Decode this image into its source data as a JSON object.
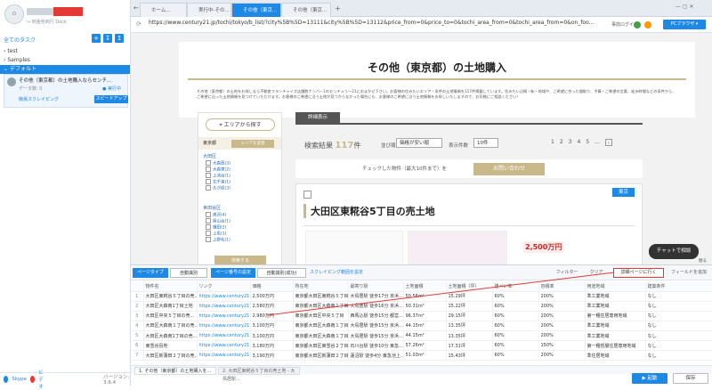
{
  "sidebar": {
    "login_link": "↪ 到金色到行 Dock",
    "title": "全てのタスク",
    "tree": [
      "test",
      "Samples",
      "デフォルト"
    ],
    "task": {
      "title": "その他（東京都）の土地購入ならセンチ...",
      "sub": "データ数: 0",
      "status": "● 実行中",
      "link": "簡易スクレイピング",
      "speedup": "スピードアップ"
    },
    "footer": {
      "skype": "Skype",
      "video": "ビデオ",
      "version": "バージョン: 3.6.4"
    }
  },
  "browser": {
    "tabs": [
      "ホーム...",
      "実行中-その...",
      "その他（東京...",
      "その他（東京..."
    ],
    "url": "https://www.century21.jp/tochi/tokyo/b_list/?city%5B%5D=13111&city%5B%5D=13112&price_from=0&price_to=0&tochi_area_from=0&tochi_area_from=0&on_foo...",
    "login": "事前ログイン",
    "pc_browser": "PCブラウザ ▾"
  },
  "page": {
    "h1": "その他（東京都）の土地購入",
    "intro": "その他（東京都）の土地をお探しなら不動産フランチャイズ店舗数ナンバー1のセンチュリー21におまかせ下さい。お客様の住みたいエリア・条件の土地情報を117件掲載しています。住みたい沿線・駅・地域や、ご希望に合った間取り、予算・ご希望の言葉、徒歩時間などの条件から、ご希望に沿った土地情報を見つけていただけます。お客様のご希望に沿う土地が見つからなかった場合にも、お客様のご希望に沿う土地情報をお探しいたしますので、お気軽にご相談ください！",
    "area_btn": "エリアから探す",
    "tokyo": "東京都",
    "change_area": "エリアを変更",
    "ward1": "大田区",
    "ward1_items": [
      "大森西(3)",
      "大森東(2)",
      "上池台(1)",
      "北千束(1)",
      "久が原(3)"
    ],
    "ward2": "世田谷区",
    "ward2_items": [
      "奥沢(4)",
      "尾山台(1)",
      "鎌田(2)",
      "上馬(1)",
      "上野毛(1)"
    ],
    "search_btn": "検索する",
    "tab": "詳細表示",
    "count_label": "検索結果",
    "count": "117",
    "count_unit": "件",
    "sort_label": "並び順",
    "sort": "価格が安い順",
    "disp_label": "表示件数",
    "disp": "10件",
    "pages": [
      "1",
      "2",
      "3",
      "4",
      "5",
      "..."
    ],
    "inq_text": "チェックした物件（最大10件まで）を",
    "inq_btn": "お問い合わせ",
    "tokyo_badge": "東京",
    "card_title": "大田区東糀谷5丁目の売土地",
    "price": "2,500万円",
    "chat": "チャットで相談",
    "close": "閉る"
  },
  "toolbar": {
    "loop": "ページタイプ",
    "auto": "自動識別",
    "paging": "ページ番号の設定",
    "auto2": "自動識別(成功)",
    "scroll": "スクレイピング範囲を設定",
    "filter": "フィルター",
    "clear": "クリア",
    "detail": "詳細ページに行く",
    "addfield": "フィールドを追加"
  },
  "table": {
    "headers": [
      "",
      "物件名",
      "リンク",
      "価格",
      "所在地",
      "最寄り駅",
      "土地面積",
      "土地面積（坪）",
      "建ぺい率",
      "容積率",
      "用途地域",
      "建築条件"
    ],
    "rows": [
      [
        "1",
        "大田区東糀谷５丁目の売...",
        "https://www.century21...",
        "2,500万円",
        "東京都大田区東糀谷５丁目",
        "大鳥居駅 徒歩17分 京浜...",
        "50.56m²",
        "15.29坪",
        "60%",
        "200%",
        "準工業地域",
        "なし"
      ],
      [
        "2",
        "大田区大森南1丁目土地",
        "https://www.century21...",
        "2,580万円",
        "東京都大田区大森南１丁目",
        "大鳥居駅 徒歩16分 京浜...",
        "50.31m²",
        "15.22坪",
        "60%",
        "200%",
        "準工業地域",
        "なし"
      ],
      [
        "3",
        "大田区中央５丁目の売...",
        "https://www.century21...",
        "2,980万円",
        "東京都大田区中央５丁目",
        "西馬込駅 徒歩15分 都営...",
        "96.37m²",
        "29.15坪",
        "60%",
        "200%",
        "第一種住居専用地域",
        "なし"
      ],
      [
        "4",
        "大田区大森南１丁目の売...",
        "https://www.century21...",
        "3,100万円",
        "東京都大田区大森南１丁目",
        "大鳥居駅 徒歩15分 京浜...",
        "44.15m²",
        "13.35坪",
        "60%",
        "200%",
        "準工業地域",
        "なし"
      ],
      [
        "5",
        "大田区大森南1丁目の売...",
        "https://www.century21...",
        "3,100万円",
        "東京都大田区大森南１丁目",
        "大鳥居駅 徒歩15分 京浜...",
        "44.15m²",
        "13.35坪",
        "60%",
        "200%",
        "準工業地域",
        "なし"
      ],
      [
        "6",
        "東雪谷島地",
        "https://www.century21...",
        "3,180万円",
        "東京都大田区東雪谷２丁目",
        "石川台駅 徒歩10分 東急...",
        "57.26m²",
        "17.31坪",
        "60%",
        "150%",
        "第一種低層住居専用地域",
        "なし"
      ],
      [
        "7",
        "大田区新蒲田２丁目の売...",
        "https://www.century21...",
        "3,190万円",
        "東京都大田区新蒲田２丁目",
        "蓮沼駅 徒歩4分 東急池上...",
        "51.03m²",
        "15.43坪",
        "60%",
        "200%",
        "準住居地域",
        "なし"
      ]
    ]
  },
  "bottom_tabs": [
    "1. その他（東京都）の土地購入を...",
    "2. 大田区東糀谷５丁目の売土地 - 大鳥居駅..."
  ],
  "actions": {
    "start": "▶ 起動",
    "save": "保存"
  },
  "colors": {
    "accent": "#1e88e5",
    "gold": "#c8b88a",
    "highlight": "#e53935"
  }
}
